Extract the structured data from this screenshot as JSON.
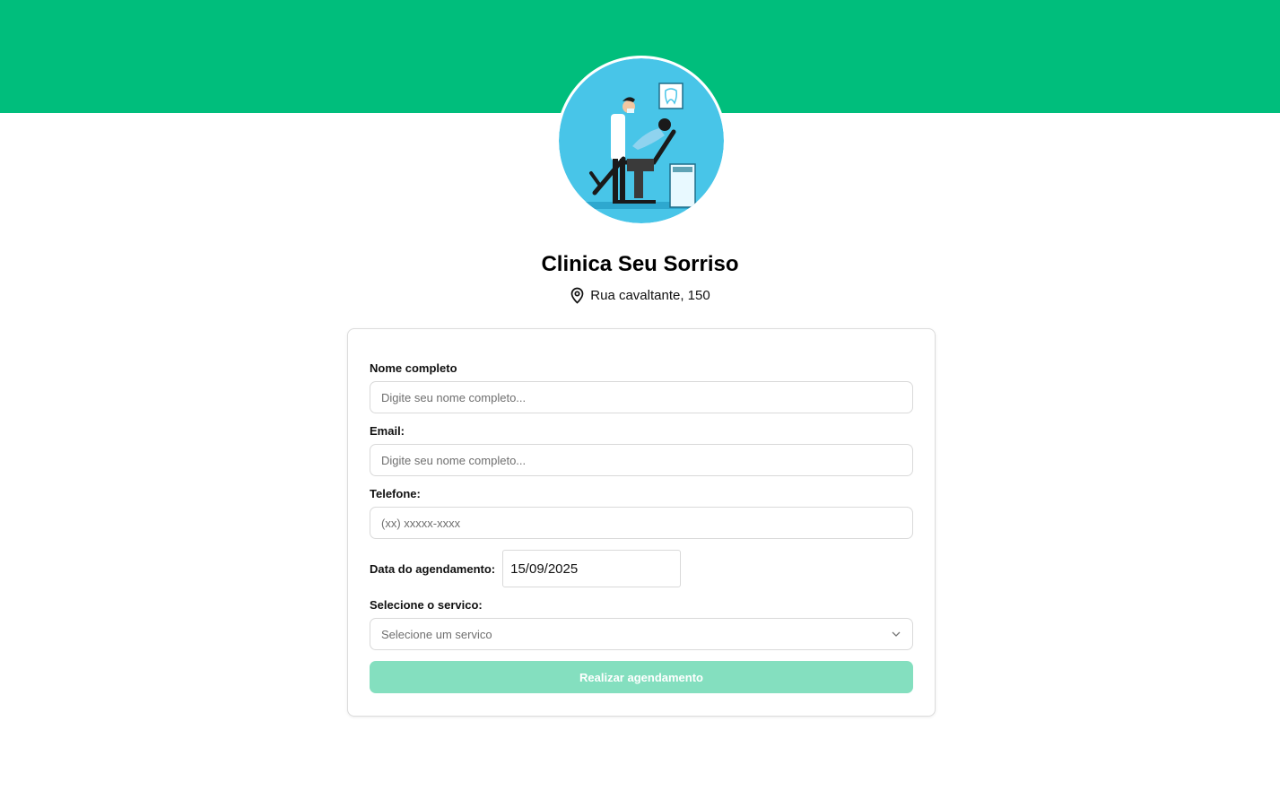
{
  "header": {
    "banner_color": "#00be7c",
    "clinic_name": "Clinica Seu Sorriso",
    "address_icon": "map-pin-icon",
    "address": "Rua cavaltante, 150",
    "avatar_icon": "dentist-illustration-icon"
  },
  "form": {
    "name_label": "Nome completo",
    "name_placeholder": "Digite seu nome completo...",
    "email_label": "Email:",
    "email_placeholder": "Digite seu nome completo...",
    "phone_label": "Telefone:",
    "phone_placeholder": "(xx) xxxxx-xxxx",
    "date_label": "Data do agendamento:",
    "date_value": "15/09/2025",
    "service_label": "Selecione o servico:",
    "service_placeholder": "Selecione um servico",
    "service_icon": "chevron-down-icon",
    "submit_label": "Realizar agendamento",
    "submit_color": "#84dfbf"
  }
}
